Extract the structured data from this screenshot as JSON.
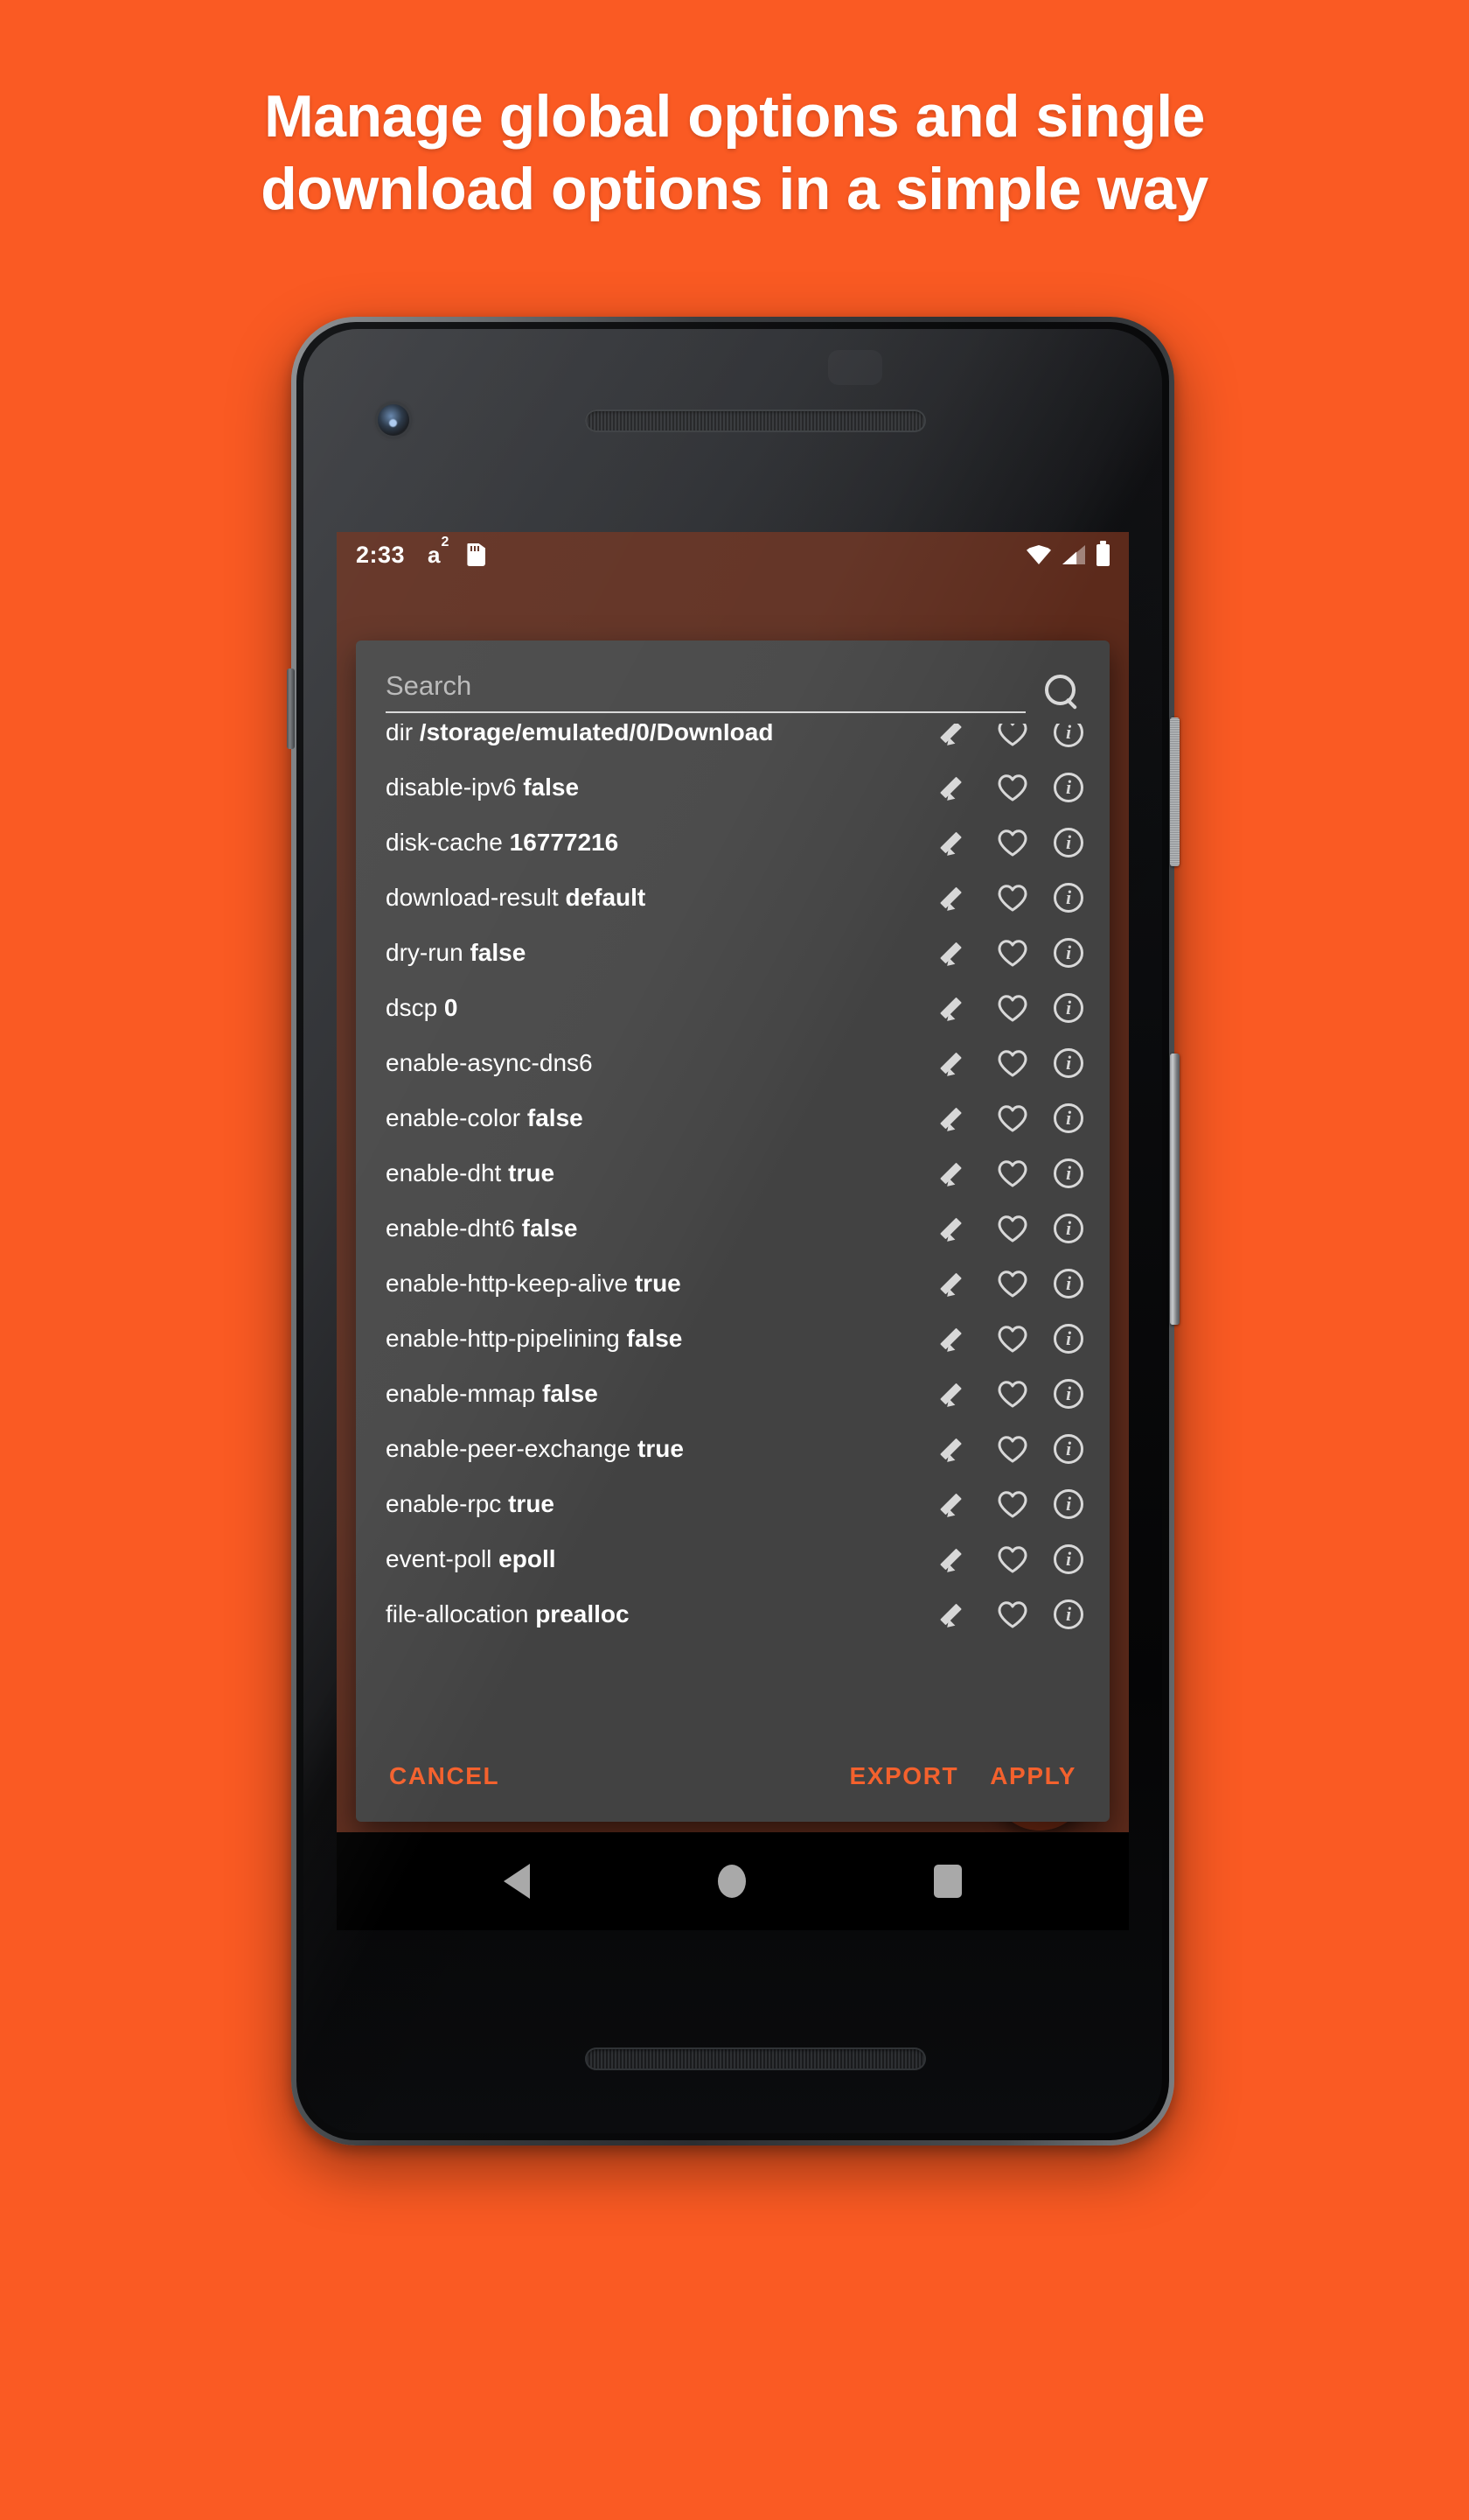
{
  "headline": {
    "line1": "Manage global options and single",
    "line2": "download options in a simple way"
  },
  "colors": {
    "background": "#fa5a23",
    "accent": "#f4612d",
    "dialog_bg": "#424242",
    "app_bg": "#5c2a1b"
  },
  "statusbar": {
    "time": "2:33",
    "a2_letter": "a",
    "a2_sup": "2",
    "icons": [
      "sdcard-icon",
      "wifi-icon",
      "cellular-signal-icon",
      "battery-icon"
    ]
  },
  "dialog": {
    "search": {
      "value": "",
      "placeholder": "Search"
    },
    "rows": [
      {
        "key": "dir",
        "value": "/storage/emulated/0/Download",
        "clipped": true
      },
      {
        "key": "disable-ipv6",
        "value": "false"
      },
      {
        "key": "disk-cache",
        "value": "16777216"
      },
      {
        "key": "download-result",
        "value": "default"
      },
      {
        "key": "dry-run",
        "value": "false"
      },
      {
        "key": "dscp",
        "value": "0"
      },
      {
        "key": "enable-async-dns6",
        "value": ""
      },
      {
        "key": "enable-color",
        "value": "false"
      },
      {
        "key": "enable-dht",
        "value": "true"
      },
      {
        "key": "enable-dht6",
        "value": "false"
      },
      {
        "key": "enable-http-keep-alive",
        "value": "true"
      },
      {
        "key": "enable-http-pipelining",
        "value": "false"
      },
      {
        "key": "enable-mmap",
        "value": "false"
      },
      {
        "key": "enable-peer-exchange",
        "value": "true"
      },
      {
        "key": "enable-rpc",
        "value": "true"
      },
      {
        "key": "event-poll",
        "value": "epoll"
      },
      {
        "key": "file-allocation",
        "value": "prealloc"
      }
    ],
    "row_icons": [
      "edit-pencil-icon",
      "favorite-heart-icon",
      "info-icon"
    ],
    "actions": {
      "cancel": "CANCEL",
      "export": "EXPORT",
      "apply": "APPLY"
    }
  },
  "navbar": {
    "back": "back-icon",
    "home": "home-icon",
    "recents": "recents-icon"
  }
}
